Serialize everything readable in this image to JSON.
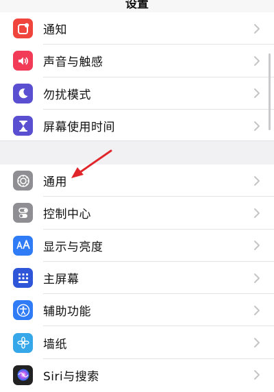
{
  "navbar": {
    "title": "设置"
  },
  "groups": [
    {
      "items": [
        {
          "label": "通知",
          "icon": "bell-icon",
          "color": "#f0453c"
        },
        {
          "label": "声音与触感",
          "icon": "speaker-icon",
          "color": "#f23b57"
        },
        {
          "label": "勿扰模式",
          "icon": "moon-icon",
          "color": "#5a4fd0"
        },
        {
          "label": "屏幕使用时间",
          "icon": "hourglass-icon",
          "color": "#5a4fd0"
        }
      ]
    },
    {
      "items": [
        {
          "label": "通用",
          "icon": "gear-icon",
          "color": "#8e8e93"
        },
        {
          "label": "控制中心",
          "icon": "toggles-icon",
          "color": "#8e8e93"
        },
        {
          "label": "显示与亮度",
          "icon": "aa-icon",
          "color": "#2f7cf6"
        },
        {
          "label": "主屏幕",
          "icon": "grid-icon",
          "color": "#2f56d9"
        },
        {
          "label": "辅助功能",
          "icon": "accessibility-icon",
          "color": "#2f7cf6"
        },
        {
          "label": "墙纸",
          "icon": "flower-icon",
          "color": "#36a7e8"
        },
        {
          "label": "Siri与搜索",
          "icon": "siri-icon",
          "color": "#222222"
        }
      ]
    }
  ],
  "annotation": {
    "arrow_color": "#e0262b"
  }
}
